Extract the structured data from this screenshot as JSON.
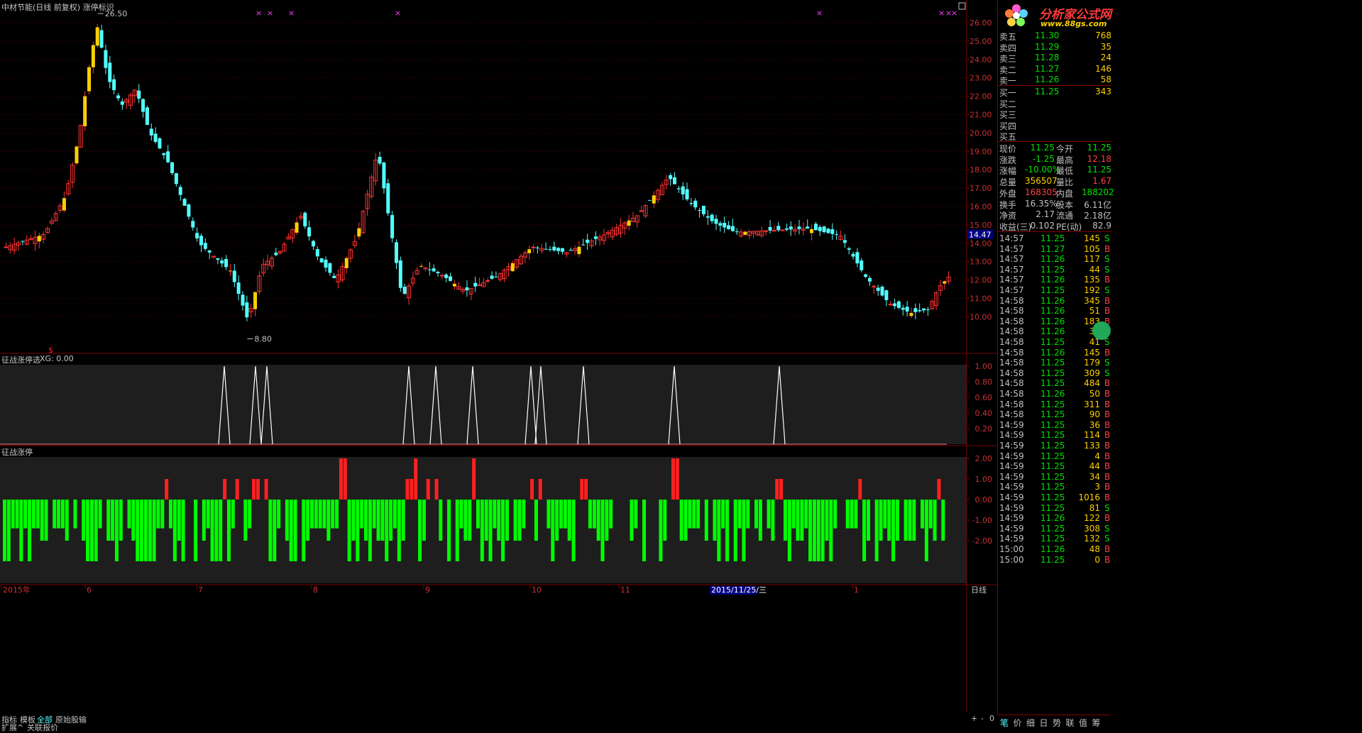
{
  "title": "中材节能(日线 前复权) 涨停标识",
  "colors": {
    "up": "#ff3232",
    "down": "#54ffff",
    "limit": "#ffd000",
    "green": "#00ff00",
    "red": "#ff2020",
    "bg": "#000000",
    "grid": "#800000"
  },
  "main_axis": {
    "ticks": [
      "26.00",
      "25.00",
      "24.00",
      "23.00",
      "22.00",
      "21.00",
      "20.00",
      "19.00",
      "18.00",
      "17.00",
      "16.00",
      "15.00",
      "14.00",
      "13.00",
      "12.00",
      "11.00",
      "10.00"
    ],
    "current": "14.47",
    "high_label": "26.50",
    "low_label": "8.80"
  },
  "panel1": {
    "title": "征战涨停选",
    "value_label": "XG: 0.00",
    "ticks": [
      "1.00",
      "0.80",
      "0.60",
      "0.40",
      "0.20"
    ]
  },
  "panel2": {
    "title": "征战涨停",
    "ticks": [
      "2.00",
      "1.00",
      "0.00",
      "-1.00",
      "-2.00"
    ]
  },
  "x_labels": [
    "2015年",
    "6",
    "7",
    "8",
    "9",
    "10",
    "11",
    "2015/11/25/三",
    "1"
  ],
  "period": "日线",
  "tabs": [
    "指标",
    "模板",
    "全部",
    "原始股输"
  ],
  "tabs2": [
    "扩展^",
    "关联报价"
  ],
  "nav": [
    "+",
    "-",
    "0"
  ],
  "orderbook": {
    "sell": [
      {
        "label": "卖五",
        "price": "11.30",
        "vol": "768"
      },
      {
        "label": "卖四",
        "price": "11.29",
        "vol": "35"
      },
      {
        "label": "卖三",
        "price": "11.28",
        "vol": "24"
      },
      {
        "label": "卖二",
        "price": "11.27",
        "vol": "146"
      },
      {
        "label": "卖一",
        "price": "11.26",
        "vol": "58"
      }
    ],
    "buy": [
      {
        "label": "买一",
        "price": "11.25",
        "vol": "343"
      },
      {
        "label": "买二",
        "price": "",
        "vol": ""
      },
      {
        "label": "买三",
        "price": "",
        "vol": ""
      },
      {
        "label": "买四",
        "price": "",
        "vol": ""
      },
      {
        "label": "买五",
        "price": "",
        "vol": ""
      }
    ]
  },
  "quote": [
    {
      "l1": "现价",
      "v1": "11.25",
      "l2": "今开",
      "v2": "11.25"
    },
    {
      "l1": "涨跌",
      "v1": "-1.25",
      "l2": "最高",
      "v2": "12.18"
    },
    {
      "l1": "涨幅",
      "v1": "-10.00%",
      "l2": "最低",
      "v2": "11.25"
    },
    {
      "l1": "总量",
      "v1": "356507",
      "l2": "量比",
      "v2": "1.67"
    },
    {
      "l1": "外盘",
      "v1": "168305",
      "l2": "内盘",
      "v2": "188202"
    },
    {
      "l1": "换手",
      "v1": "16.35%",
      "l2": "股本",
      "v2": "6.11亿"
    },
    {
      "l1": "净资",
      "v1": "2.17",
      "l2": "流通",
      "v2": "2.18亿"
    },
    {
      "l1": "收益(三)",
      "v1": "0.102",
      "l2": "PE(动)",
      "v2": "82.9"
    }
  ],
  "ticks": [
    {
      "t": "14:57",
      "p": "11.25",
      "v": "145",
      "s": "S"
    },
    {
      "t": "14:57",
      "p": "11.27",
      "v": "105",
      "s": "B"
    },
    {
      "t": "14:57",
      "p": "11.26",
      "v": "117",
      "s": "S"
    },
    {
      "t": "14:57",
      "p": "11.25",
      "v": "44",
      "s": "S"
    },
    {
      "t": "14:57",
      "p": "11.26",
      "v": "135",
      "s": "B"
    },
    {
      "t": "14:57",
      "p": "11.25",
      "v": "192",
      "s": "S"
    },
    {
      "t": "14:58",
      "p": "11.26",
      "v": "345",
      "s": "B"
    },
    {
      "t": "14:58",
      "p": "11.26",
      "v": "51",
      "s": "B"
    },
    {
      "t": "14:58",
      "p": "11.26",
      "v": "183",
      "s": "B"
    },
    {
      "t": "14:58",
      "p": "11.26",
      "v": "38",
      "s": "B"
    },
    {
      "t": "14:58",
      "p": "11.25",
      "v": "41",
      "s": "S"
    },
    {
      "t": "14:58",
      "p": "11.26",
      "v": "145",
      "s": "B"
    },
    {
      "t": "14:58",
      "p": "11.25",
      "v": "179",
      "s": "S"
    },
    {
      "t": "14:58",
      "p": "11.25",
      "v": "309",
      "s": "S"
    },
    {
      "t": "14:58",
      "p": "11.25",
      "v": "484",
      "s": "B"
    },
    {
      "t": "14:58",
      "p": "11.26",
      "v": "50",
      "s": "B"
    },
    {
      "t": "14:58",
      "p": "11.25",
      "v": "311",
      "s": "B"
    },
    {
      "t": "14:58",
      "p": "11.25",
      "v": "90",
      "s": "B"
    },
    {
      "t": "14:59",
      "p": "11.25",
      "v": "36",
      "s": "B"
    },
    {
      "t": "14:59",
      "p": "11.25",
      "v": "114",
      "s": "B"
    },
    {
      "t": "14:59",
      "p": "11.25",
      "v": "133",
      "s": "B"
    },
    {
      "t": "14:59",
      "p": "11.25",
      "v": "4",
      "s": "B"
    },
    {
      "t": "14:59",
      "p": "11.25",
      "v": "44",
      "s": "B"
    },
    {
      "t": "14:59",
      "p": "11.25",
      "v": "34",
      "s": "B"
    },
    {
      "t": "14:59",
      "p": "11.25",
      "v": "3",
      "s": "B"
    },
    {
      "t": "14:59",
      "p": "11.25",
      "v": "1016",
      "s": "B"
    },
    {
      "t": "14:59",
      "p": "11.25",
      "v": "81",
      "s": "S"
    },
    {
      "t": "14:59",
      "p": "11.26",
      "v": "122",
      "s": "B"
    },
    {
      "t": "14:59",
      "p": "11.25",
      "v": "308",
      "s": "S"
    },
    {
      "t": "14:59",
      "p": "11.25",
      "v": "132",
      "s": "S"
    },
    {
      "t": "15:00",
      "p": "11.26",
      "v": "48",
      "s": "B"
    },
    {
      "t": "15:00",
      "p": "11.25",
      "v": "0",
      "s": "B"
    }
  ],
  "bottom_tabs": [
    "笔",
    "价",
    "细",
    "日",
    "势",
    "联",
    "值",
    "筹"
  ],
  "logo": {
    "line1": "分析家公式网",
    "line2": "www.88gs.com"
  }
}
